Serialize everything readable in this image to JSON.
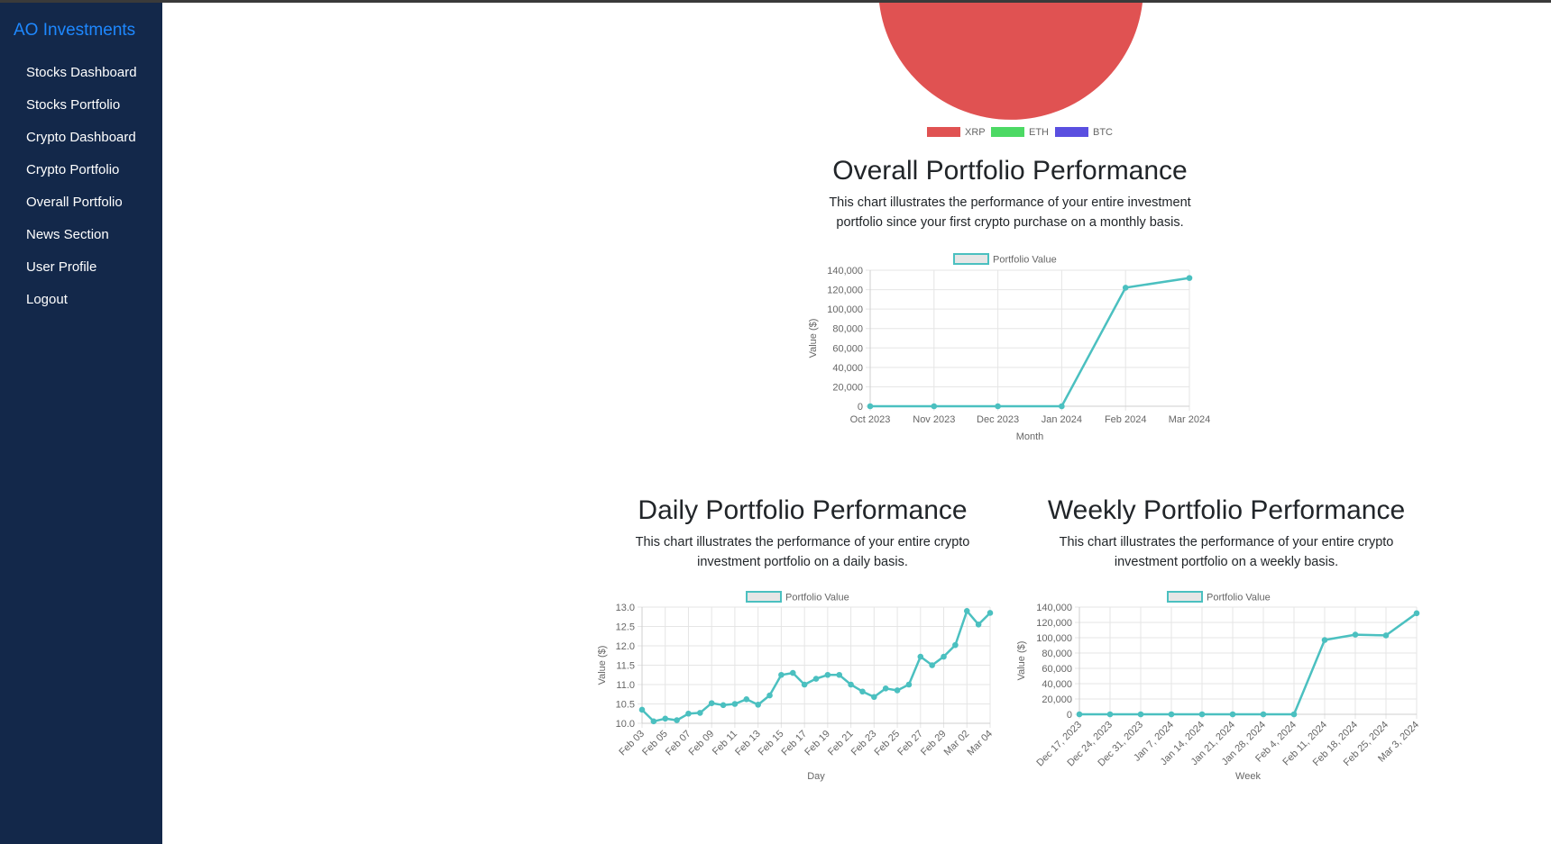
{
  "sidebar": {
    "brand": "AO Investments",
    "items": [
      {
        "label": "Stocks Dashboard"
      },
      {
        "label": "Stocks Portfolio"
      },
      {
        "label": "Crypto Dashboard"
      },
      {
        "label": "Crypto Portfolio"
      },
      {
        "label": "Overall Portfolio"
      },
      {
        "label": "News Section"
      },
      {
        "label": "User Profile"
      },
      {
        "label": "Logout"
      }
    ]
  },
  "pie": {
    "legend": [
      {
        "label": "XRP",
        "color": "#e05252"
      },
      {
        "label": "ETH",
        "color": "#4cd964"
      },
      {
        "label": "BTC",
        "color": "#5a4fe0"
      }
    ]
  },
  "overall": {
    "title": "Overall Portfolio Performance",
    "description": "This chart illustrates the performance of your entire investment portfolio since your first crypto purchase on a monthly basis."
  },
  "daily": {
    "title": "Daily Portfolio Performance",
    "description": "This chart illustrates the performance of your entire crypto investment portfolio on a daily basis."
  },
  "weekly": {
    "title": "Weekly Portfolio Performance",
    "description": "This chart illustrates the performance of your entire crypto investment portfolio on a weekly basis."
  },
  "chart_data": [
    {
      "type": "pie",
      "categories": [
        "XRP",
        "ETH",
        "BTC"
      ],
      "colors": [
        "#e05252",
        "#4cd964",
        "#5a4fe0"
      ],
      "legend_position": "bottom"
    },
    {
      "type": "line",
      "legend": "Portfolio Value",
      "color": "#4bc0c0",
      "xlabel": "Month",
      "ylabel": "Value ($)",
      "categories": [
        "Oct 2023",
        "Nov 2023",
        "Dec 2023",
        "Jan 2024",
        "Feb 2024",
        "Mar 2024"
      ],
      "values": [
        0,
        0,
        0,
        0,
        122000,
        132000
      ],
      "ylim": [
        0,
        140000
      ],
      "yticks": [
        "0",
        "20,000",
        "40,000",
        "60,000",
        "80,000",
        "100,000",
        "120,000",
        "140,000"
      ],
      "grid": true
    },
    {
      "type": "line",
      "legend": "Portfolio Value",
      "color": "#4bc0c0",
      "xlabel": "Day",
      "ylabel": "Value ($)",
      "categories": [
        "Feb 03",
        "Feb 05",
        "Feb 07",
        "Feb 09",
        "Feb 11",
        "Feb 13",
        "Feb 15",
        "Feb 17",
        "Feb 19",
        "Feb 21",
        "Feb 23",
        "Feb 25",
        "Feb 27",
        "Feb 29",
        "Mar 02",
        "Mar 04"
      ],
      "values": [
        10.35,
        10.05,
        10.12,
        10.08,
        10.25,
        10.27,
        10.52,
        10.47,
        10.5,
        10.62,
        10.48,
        10.72,
        11.25,
        11.3,
        11.0,
        11.15,
        11.25,
        11.25,
        11.0,
        10.82,
        10.68,
        10.9,
        10.85,
        11.0,
        11.72,
        11.5,
        11.72,
        12.02,
        12.9,
        12.55,
        12.85
      ],
      "ylim": [
        10.0,
        13.0
      ],
      "yticks": [
        "10.0",
        "10.5",
        "11.0",
        "11.5",
        "12.0",
        "12.5",
        "13.0"
      ],
      "grid": true
    },
    {
      "type": "line",
      "legend": "Portfolio Value",
      "color": "#4bc0c0",
      "xlabel": "Week",
      "ylabel": "Value ($)",
      "categories": [
        "Dec 17, 2023",
        "Dec 24, 2023",
        "Dec 31, 2023",
        "Jan 7, 2024",
        "Jan 14, 2024",
        "Jan 21, 2024",
        "Jan 28, 2024",
        "Feb 4, 2024",
        "Feb 11, 2024",
        "Feb 18, 2024",
        "Feb 25, 2024",
        "Mar 3, 2024"
      ],
      "values": [
        0,
        0,
        0,
        0,
        0,
        0,
        0,
        0,
        97000,
        104000,
        103000,
        132000
      ],
      "ylim": [
        0,
        140000
      ],
      "yticks": [
        "0",
        "20,000",
        "40,000",
        "60,000",
        "80,000",
        "100,000",
        "120,000",
        "140,000"
      ],
      "grid": true
    }
  ]
}
